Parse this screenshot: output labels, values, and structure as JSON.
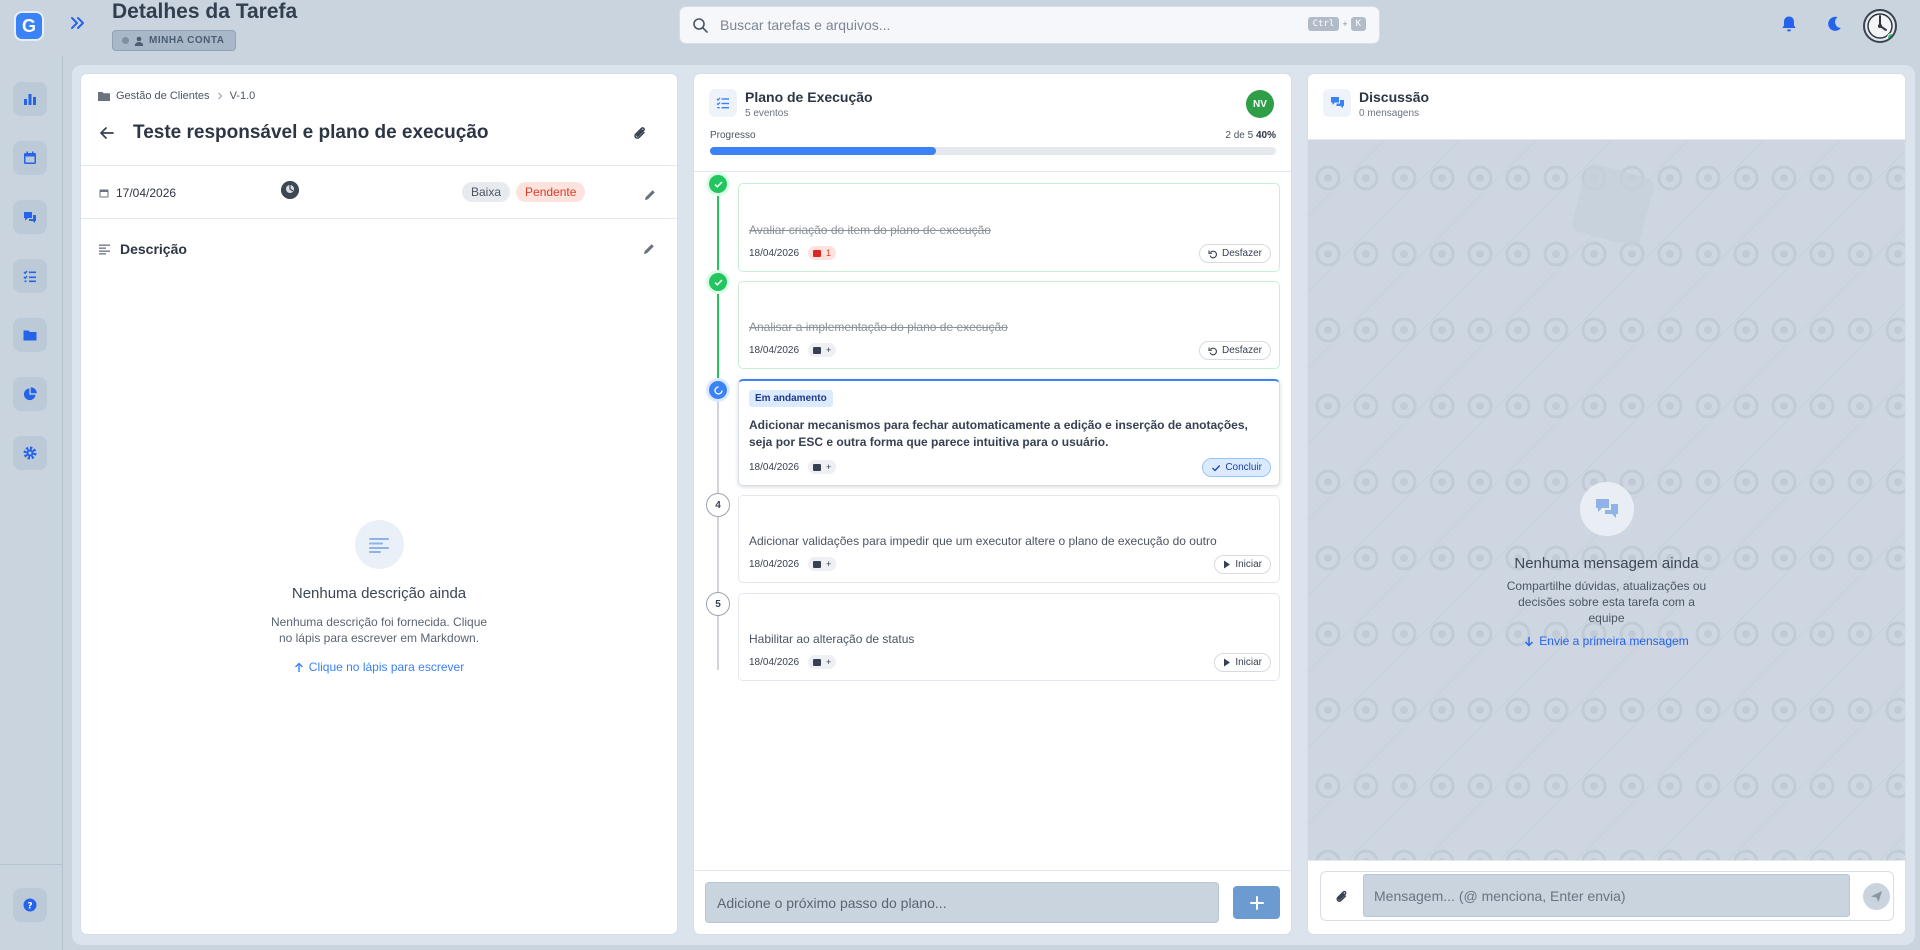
{
  "header": {
    "logo_letter": "G",
    "title": "Detalhes da Tarefa",
    "account_label": "MINHA CONTA",
    "search_placeholder": "Buscar tarefas e arquivos...",
    "shortcut_key1": "Ctrl",
    "shortcut_plus": "+",
    "shortcut_key2": "K"
  },
  "sidebar": {
    "items": [
      {
        "icon": "bar-chart-icon"
      },
      {
        "icon": "calendar-icon"
      },
      {
        "icon": "chat-icon"
      },
      {
        "icon": "task-list-icon"
      },
      {
        "icon": "folder-icon"
      },
      {
        "icon": "pie-chart-icon"
      },
      {
        "icon": "gear-icon"
      }
    ],
    "help_icon": "help-icon"
  },
  "task": {
    "breadcrumb": [
      "Gestão de Clientes",
      "V-1.0"
    ],
    "title": "Teste responsável e plano de execução",
    "date": "17/04/2026",
    "priority": "Baixa",
    "status": "Pendente",
    "description_heading": "Descrição",
    "empty_title": "Nenhuma descrição ainda",
    "empty_text": "Nenhuma descrição foi fornecida. Clique no lápis para escrever em Markdown.",
    "empty_link": "Clique no lápis para escrever"
  },
  "plan": {
    "title": "Plano de Execução",
    "subtitle": "5 eventos",
    "owner_initials": "NV",
    "progress_label": "Progresso",
    "progress_count": "2 de 5",
    "progress_percent": "40%",
    "progress_fraction": 0.4,
    "steps": [
      {
        "number": "",
        "state": "done",
        "text": "Avaliar criação do item do plano de execução",
        "date": "18/04/2026",
        "comments": "1",
        "action": "Desfazer"
      },
      {
        "number": "",
        "state": "done",
        "text": "Analisar a implementação do plano de execução",
        "date": "18/04/2026",
        "comments": "+",
        "action": "Desfazer"
      },
      {
        "number": "",
        "state": "current",
        "status": "Em andamento",
        "text": "Adicionar mecanismos para fechar automaticamente a edição e inserção de anotações, seja por ESC e outra forma que parece intuitiva para o usuário.",
        "date": "18/04/2026",
        "comments": "+",
        "action": "Concluir"
      },
      {
        "number": "4",
        "state": "todo",
        "text": "Adicionar validações para impedir que um executor altere o plano de execução do outro",
        "date": "18/04/2026",
        "comments": "+",
        "action": "Iniciar"
      },
      {
        "number": "5",
        "state": "todo",
        "text": "Habilitar ao alteração de status",
        "date": "18/04/2026",
        "comments": "+",
        "action": "Iniciar"
      }
    ],
    "add_placeholder": "Adicione o próximo passo do plano..."
  },
  "discussion": {
    "title": "Discussão",
    "subtitle": "0 mensagens",
    "empty_title": "Nenhuma mensagem ainda",
    "empty_text": "Compartilhe dúvidas, atualizações ou decisões sobre esta tarefa com a equipe",
    "empty_link": "Envie a primeira mensagem",
    "message_placeholder": "Mensagem... (@ menciona, Enter envia)"
  },
  "colors": {
    "accent": "#3b82f6",
    "done": "#22c55e",
    "pending_badge": "#dc3d28",
    "owner_avatar": "#2e9f46"
  }
}
